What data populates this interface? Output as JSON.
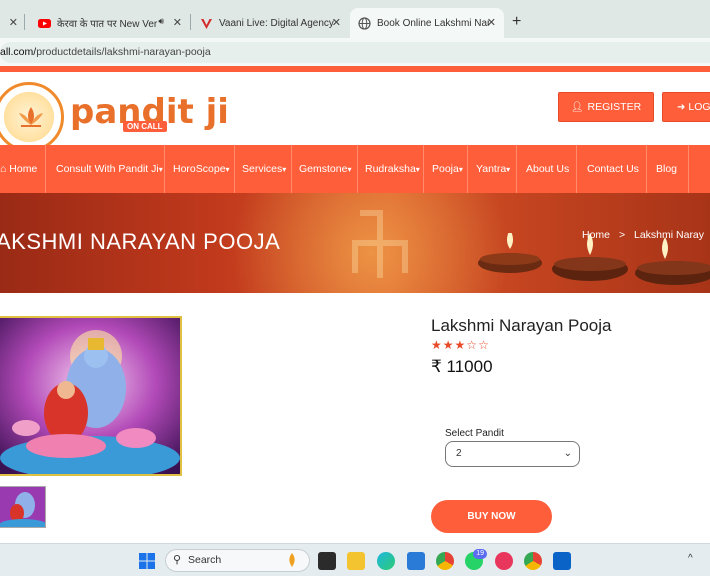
{
  "browser": {
    "tabs": [
      {
        "title": "केरवा के पात पर New Version",
        "active": false
      },
      {
        "title": "Vaani Live: Digital Agency, Web",
        "active": false
      },
      {
        "title": "Book Online Lakshmi Narayan P",
        "active": true
      }
    ],
    "url_prefix": "all.com/",
    "url_path": "productdetails/lakshmi-narayan-pooja"
  },
  "header": {
    "logo_text": "pandit",
    "logo_ji": "ji",
    "logo_oncall": "ON CALL",
    "register_label": "REGISTER",
    "login_label": "LOG"
  },
  "nav": {
    "items": [
      "Home",
      "Consult With Pandit Ji",
      "HoroScope",
      "Services",
      "Gemstone",
      "Rudraksha",
      "Pooja",
      "Yantra",
      "About Us",
      "Contact Us",
      "Blog"
    ]
  },
  "banner": {
    "title": "AKSHMI NARAYAN POOJA",
    "crumb_home": "Home",
    "crumb_sep": ">",
    "crumb_current": "Lakshmi Naray"
  },
  "product": {
    "title": "Lakshmi Narayan Pooja",
    "rating": 3,
    "rating_max": 5,
    "price": "₹ 11000",
    "select_label": "Select Pandit",
    "select_value": "2",
    "buy_label": "BUY NOW"
  },
  "taskbar": {
    "search_placeholder": "Search",
    "whatsapp_badge": "19"
  },
  "colors": {
    "accent": "#ff5e3a",
    "logo_orange": "#e8702a"
  }
}
